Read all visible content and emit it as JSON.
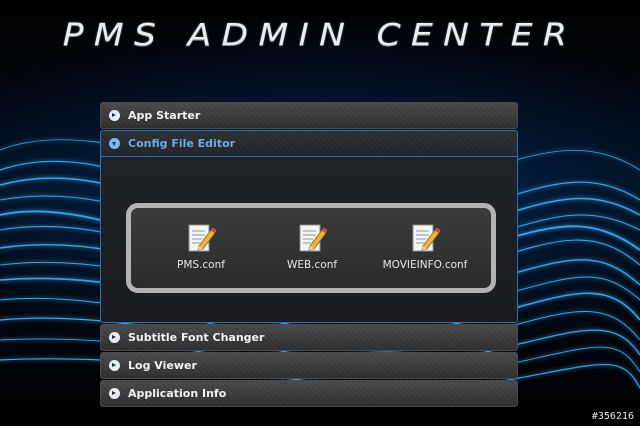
{
  "header": {
    "title": "PMS ADMIN CENTER"
  },
  "panels": [
    {
      "label": "App Starter",
      "expanded": false
    },
    {
      "label": "Config File Editor",
      "expanded": true
    },
    {
      "label": "Subtitle Font Changer",
      "expanded": false
    },
    {
      "label": "Log Viewer",
      "expanded": false
    },
    {
      "label": "Application Info",
      "expanded": false
    }
  ],
  "config_files": [
    {
      "name": "PMS.conf",
      "icon": "edit-file-icon"
    },
    {
      "name": "WEB.conf",
      "icon": "edit-file-icon"
    },
    {
      "name": "MOVIEINFO.conf",
      "icon": "edit-file-icon"
    }
  ],
  "watermark": "#356216",
  "colors": {
    "accent_active": "#6ea9e6",
    "panel_border_active": "#2a6fb0",
    "header_bg": "#3a3a3a",
    "file_box_border": "#b3b3b3",
    "background": "#000000"
  }
}
